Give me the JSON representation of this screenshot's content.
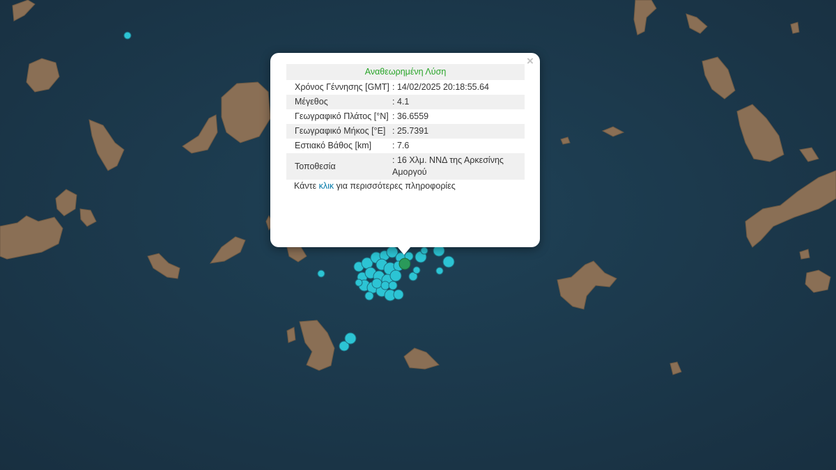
{
  "popup": {
    "close_glyph": "×",
    "header": "Αναθεωρημένη Λύση",
    "rows": [
      {
        "label": "Χρόνος Γέννησης [GMT]",
        "value": ": 14/02/2025 20:18:55.64"
      },
      {
        "label": "Μέγεθος",
        "value": ": 4.1"
      },
      {
        "label": "Γεωγραφικό Πλάτος [°N]",
        "value": ": 36.6559"
      },
      {
        "label": "Γεωγραφικό Μήκος [°E]",
        "value": ": 25.7391"
      },
      {
        "label": "Εστιακό Βάθος [km]",
        "value": ": 7.6"
      },
      {
        "label": "Τοποθεσία",
        "value": ": 16 Χλμ. ΝΝΔ της Αρκεσίνης Αμοργού"
      }
    ],
    "footer_pre": "Κάντε ",
    "footer_link": "κλικ",
    "footer_post": " για περισσότερες πληροφορίες"
  },
  "colors": {
    "sea": "#1c3a4e",
    "land": "#8a6f55",
    "marker_fill": "#2cc4d4",
    "selected_marker": "#2a9a5a",
    "header_text": "#28a428",
    "link": "#0078a8"
  }
}
